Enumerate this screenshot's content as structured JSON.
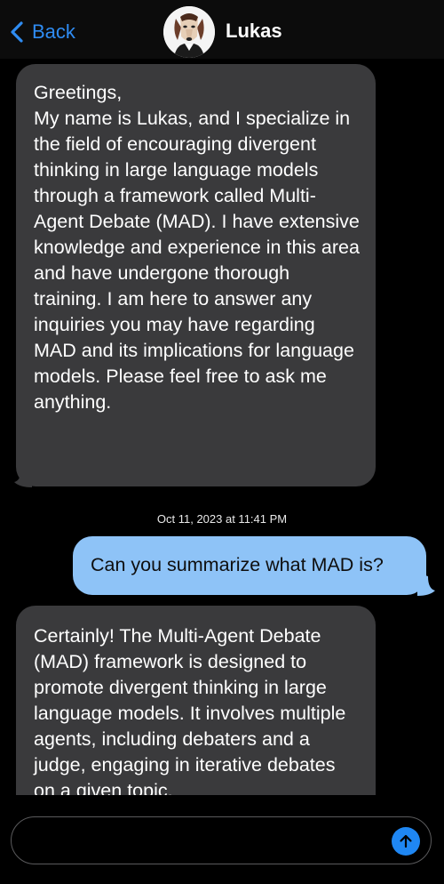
{
  "header": {
    "back_label": "Back",
    "contact_name": "Lukas"
  },
  "messages": [
    {
      "direction": "incoming",
      "text": "Greetings,\nMy name is Lukas, and I specialize in the field of encouraging divergent thinking in large language models through a framework called Multi-Agent Debate (MAD). I have extensive knowledge and experience in this area and have undergone thorough training. I am here to answer any inquiries you may have regarding MAD and its implications for language models. Please feel free to ask me anything."
    },
    {
      "direction": "outgoing",
      "text": "Can you summarize what MAD is?"
    },
    {
      "direction": "incoming",
      "text": "Certainly! The Multi-Agent Debate (MAD) framework is designed to promote divergent thinking in large language models. It involves multiple agents, including debaters and a judge, engaging in iterative debates on a given topic."
    }
  ],
  "timestamp": "Oct 11, 2023 at 11:41 PM",
  "composer": {
    "value": "",
    "send_icon": "arrow-up-icon"
  },
  "colors": {
    "incoming_bubble": "#3a3a3c",
    "outgoing_bubble": "#8ec3f7",
    "accent": "#1f87f3",
    "back_link": "#2f8cf2"
  }
}
